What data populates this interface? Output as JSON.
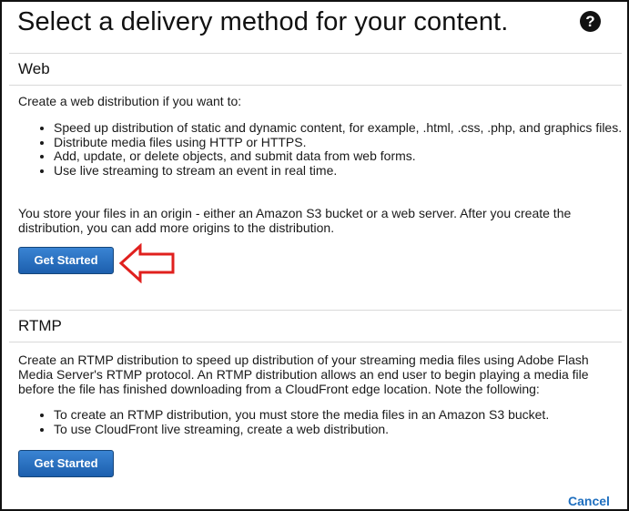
{
  "dialog": {
    "title": "Select a delivery method for your content.",
    "help_icon": "question-circle-icon",
    "cancel_label": "Cancel"
  },
  "web": {
    "heading": "Web",
    "intro": "Create a web distribution if you want to:",
    "bullets": [
      "Speed up distribution of static and dynamic content, for example, .html, .css, .php, and graphics files.",
      "Distribute media files using HTTP or HTTPS.",
      "Add, update, or delete objects, and submit data from web forms.",
      "Use live streaming to stream an event in real time."
    ],
    "origin_text": "You store your files in an origin - either an Amazon S3 bucket or a web server. After you create the distribution, you can add more origins to the distribution.",
    "button_label": "Get Started",
    "annotation_icon": "red-arrow-left-icon"
  },
  "rtmp": {
    "heading": "RTMP",
    "intro": "Create an RTMP distribution to speed up distribution of your streaming media files using Adobe Flash Media Server's RTMP protocol. An RTMP distribution allows an end user to begin playing a media file before the file has finished downloading from a CloudFront edge location. Note the following:",
    "bullets": [
      "To create an RTMP distribution, you must store the media files in an Amazon S3 bucket.",
      "To use CloudFront live streaming, create a web distribution."
    ],
    "button_label": "Get Started"
  },
  "colors": {
    "button_top": "#3a84d3",
    "button_bottom": "#1c5fae",
    "link": "#1f6fbf",
    "annotation": "#e0201e"
  }
}
